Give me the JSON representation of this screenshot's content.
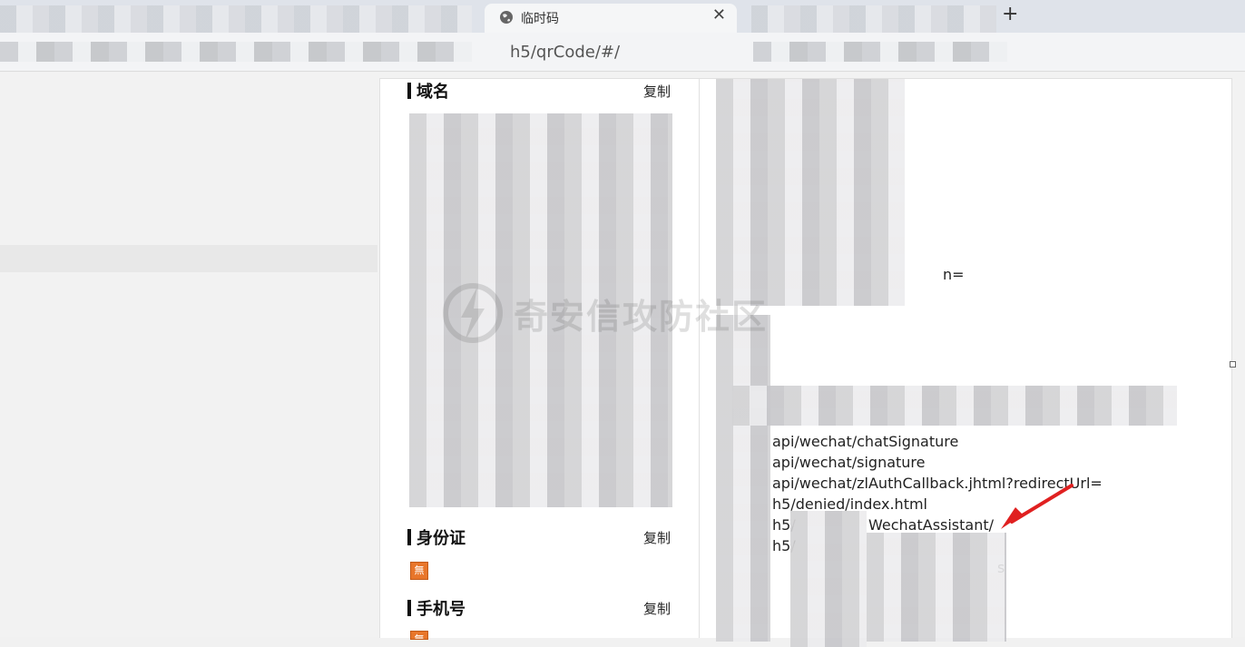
{
  "browser": {
    "active_tab_title": "临时码",
    "close_glyph": "✕",
    "new_tab_glyph": "+",
    "address": "h5/qrCode/#/"
  },
  "sections": {
    "domain": {
      "title": "域名",
      "copy_label": "复制"
    },
    "id_card": {
      "title": "身份证",
      "copy_label": "复制",
      "badge": "無"
    },
    "phone": {
      "title": "手机号",
      "copy_label": "复制",
      "badge": "無"
    }
  },
  "right_panel": {
    "partial_line": "n=",
    "api_lines": [
      "api/wechat/chatSignature",
      "api/wechat/signature",
      "api/wechat/zlAuthCallback.jhtml?redirectUrl=",
      "h5/denied/index.html",
      "h5/",
      "WechatAssistant/",
      "h5/",
      "s"
    ]
  },
  "watermark": {
    "text": "奇安信攻防社区"
  },
  "colors": {
    "arrow": "#e02020",
    "badge": "#e8762b"
  },
  "icons": {
    "tab": "globe-icon",
    "arrow": "red-arrow-icon",
    "badge": "no-data-icon"
  }
}
